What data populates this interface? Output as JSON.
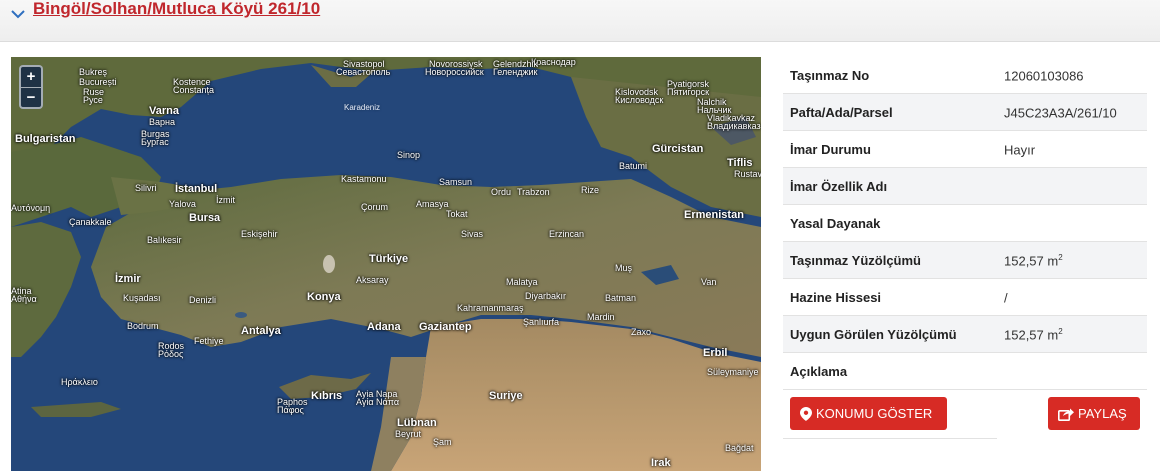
{
  "header": {
    "title": "Bingöl/Solhan/Mutluca Köyü 261/10",
    "icon": "chevron-down-icon"
  },
  "map": {
    "zoom_in": "+",
    "zoom_out": "−",
    "labels": {
      "bukres": "Bukreş",
      "bucuresti": "București",
      "sivastopol": "Sivastopol",
      "sevastopol": "Севастополь",
      "novorossiysk": "Novorossiysk",
      "novorossiysk_ru": "Новороссийск",
      "krasnodar": "Краснодар",
      "gelendzhik": "Gelendzhik",
      "gelendzhik_ru": "Геленджик",
      "konstanta": "Kostence",
      "constanta": "Constanța",
      "ruse": "Ruse",
      "ruse_bg": "Русе",
      "pyatigorsk": "Pyatigorsk",
      "pyatigorsk_ru": "Пятигорск",
      "kislovodsk": "Kislovodsk",
      "kislovodsk_ru": "Кисловодск",
      "nalchik": "Nalchik",
      "nalchik_ru": "Нальчик",
      "varna": "Varna",
      "varna_bg": "Варна",
      "burgas": "Burgas",
      "burgas_bg": "Бургас",
      "vladikavkaz": "Vladikavkaz",
      "vladikavkaz_ru": "Владикавказ",
      "karadeniz": "Karadeniz",
      "bulgaristan": "Bulgaristan",
      "sinop": "Sinop",
      "gurcistan": "Gürcistan",
      "batumi": "Batumi",
      "tiflis": "Tiflis",
      "rustavi": "Rustavi",
      "silivri": "Silivri",
      "istanbul": "İstanbul",
      "kastamonu": "Kastamonu",
      "samsun": "Samsun",
      "ordu": "Ordu",
      "trabzon": "Trabzon",
      "rize": "Rize",
      "izmit": "İzmit",
      "yalova": "Yalova",
      "corum": "Çorum",
      "amasya": "Amasya",
      "bursa": "Bursa",
      "tokat": "Tokat",
      "avrupa": "Αυτόνομη",
      "canakkale": "Çanakkale",
      "ermenistan": "Ermenistan",
      "eskisehir": "Eskişehir",
      "sivas": "Sivas",
      "erzincan": "Erzincan",
      "balikesir": "Balıkesir",
      "turkiye": "Türkiye",
      "izmir": "İzmir",
      "aksaray": "Aksaray",
      "mus": "Muş",
      "van": "Van",
      "atina": "Atina",
      "athina": "Αθήνα",
      "malatya": "Malatya",
      "konya": "Konya",
      "kusadasi": "Kuşadası",
      "denizli": "Denizli",
      "diyarbakir": "Diyarbakır",
      "batman": "Batman",
      "kahramanmaras": "Kahramanmaraş",
      "bodrum": "Bodrum",
      "mardin": "Mardin",
      "sanliurfa": "Şanlıurfa",
      "antalya": "Antalya",
      "adana": "Adana",
      "gaziantep": "Gaziantep",
      "fethiye": "Fethiye",
      "zakho": "Zaxo",
      "rodos": "Rodos",
      "rodos_gr": "Ρόδος",
      "erbil": "Erbil",
      "iraklio": "Ηράκλειο",
      "kibris": "Kıbrıs",
      "aya_napa": "Ayia Napa",
      "aya_napa_gr": "Αγία Νάπα",
      "pafos": "Paphos",
      "pafos_gr": "Πάφος",
      "suriye": "Suriye",
      "suleymaniye": "Süleymaniye",
      "lubnan": "Lübnan",
      "sam": "Şam",
      "irak": "Irak",
      "bagdat": "Bağdat",
      "beyrut": "Beyrut"
    }
  },
  "property": {
    "rows": [
      {
        "key": "Taşınmaz No",
        "value": "12060103086",
        "unit": ""
      },
      {
        "key": "Pafta/Ada/Parsel",
        "value": "J45C23A3A/261/10",
        "unit": ""
      },
      {
        "key": "İmar Durumu",
        "value": "Hayır",
        "unit": ""
      },
      {
        "key": "İmar Özellik Adı",
        "value": "",
        "unit": ""
      },
      {
        "key": "Yasal Dayanak",
        "value": "",
        "unit": ""
      },
      {
        "key": "Taşınmaz Yüzölçümü",
        "value": "152,57 m",
        "unit": "2"
      },
      {
        "key": "Hazine Hissesi",
        "value": "/",
        "unit": ""
      },
      {
        "key": "Uygun Görülen Yüzölçümü",
        "value": "152,57 m",
        "unit": "2"
      },
      {
        "key": "Açıklama",
        "value": "",
        "unit": ""
      }
    ]
  },
  "actions": {
    "locate_label": "KONUMU GÖSTER",
    "locate_icon": "map-marker-icon",
    "share_label": "PAYLAŞ",
    "share_icon": "share-icon"
  },
  "colors": {
    "accent": "#d72b25",
    "title": "#c0272d"
  }
}
